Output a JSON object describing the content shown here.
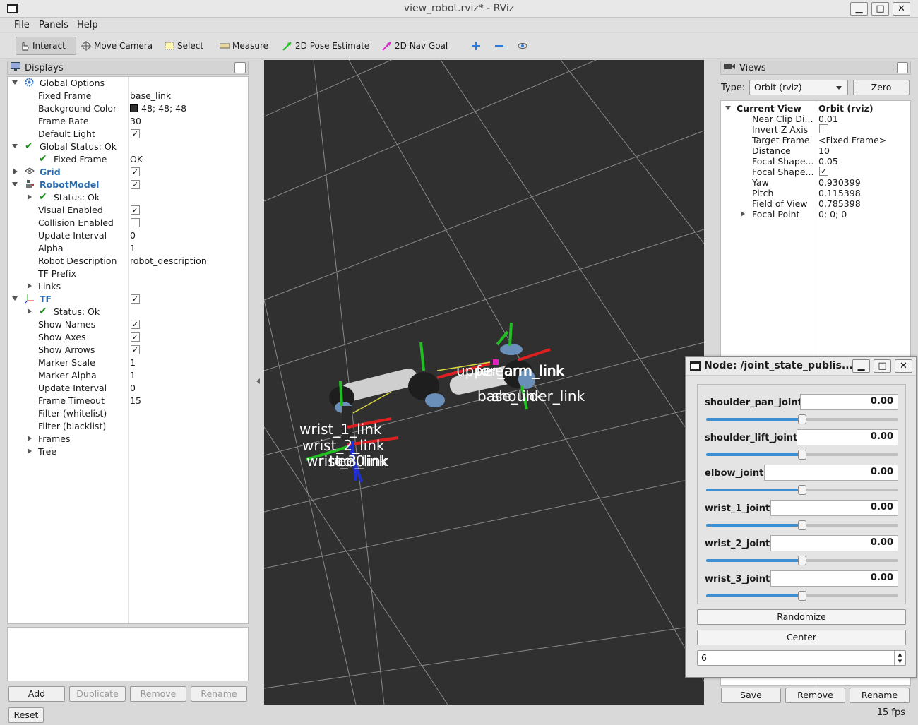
{
  "window": {
    "title": "view_robot.rviz* - RViz"
  },
  "menu": [
    "File",
    "Panels",
    "Help"
  ],
  "toolbar": {
    "interact": "Interact",
    "move_camera": "Move Camera",
    "select": "Select",
    "measure": "Measure",
    "pose_estimate": "2D Pose Estimate",
    "nav_goal": "2D Nav Goal"
  },
  "displays": {
    "title": "Displays",
    "global_options": "Global Options",
    "fixed_frame_label": "Fixed Frame",
    "fixed_frame": "base_link",
    "bg_color_label": "Background Color",
    "bg_color": "48; 48; 48",
    "frame_rate_label": "Frame Rate",
    "frame_rate": "30",
    "default_light_label": "Default Light",
    "global_status": "Global Status: Ok",
    "fixed_frame_status_label": "Fixed Frame",
    "fixed_frame_status": "OK",
    "grid": "Grid",
    "robot_model": "RobotModel",
    "status_ok": "Status: Ok",
    "visual_enabled": "Visual Enabled",
    "collision_enabled": "Collision Enabled",
    "update_interval_label": "Update Interval",
    "update_interval": "0",
    "alpha_label": "Alpha",
    "alpha": "1",
    "robot_desc_label": "Robot Description",
    "robot_desc": "robot_description",
    "tf_prefix": "TF Prefix",
    "links": "Links",
    "tf": "TF",
    "tf_status": "Status: Ok",
    "show_names": "Show Names",
    "show_axes": "Show Axes",
    "show_arrows": "Show Arrows",
    "marker_scale_label": "Marker Scale",
    "marker_scale": "1",
    "marker_alpha_label": "Marker Alpha",
    "marker_alpha": "1",
    "tf_update_interval_label": "Update Interval",
    "tf_update_interval": "0",
    "frame_timeout_label": "Frame Timeout",
    "frame_timeout": "15",
    "filter_white": "Filter (whitelist)",
    "filter_black": "Filter (blacklist)",
    "frames": "Frames",
    "tree": "Tree",
    "buttons": {
      "add": "Add",
      "duplicate": "Duplicate",
      "remove": "Remove",
      "rename": "Rename",
      "reset": "Reset"
    }
  },
  "scene": {
    "labels": [
      "wrist_1_link",
      "wrist_2_link",
      "wrist_3_link",
      "tool0",
      "ee_link",
      "upper_arm_link",
      "forearm_link",
      "base_link",
      "shoulder_link"
    ]
  },
  "views": {
    "title": "Views",
    "type_label": "Type:",
    "type_value": "Orbit (rviz)",
    "zero": "Zero",
    "current_view": "Current View",
    "current_view_val": "Orbit (rviz)",
    "rows": [
      {
        "label": "Near Clip Di...",
        "value": "0.01"
      },
      {
        "label": "Invert Z Axis",
        "value": ""
      },
      {
        "label": "Target Frame",
        "value": "<Fixed Frame>"
      },
      {
        "label": "Distance",
        "value": "10"
      },
      {
        "label": "Focal Shape...",
        "value": "0.05"
      },
      {
        "label": "Focal Shape...",
        "value": ""
      },
      {
        "label": "Yaw",
        "value": "0.930399"
      },
      {
        "label": "Pitch",
        "value": "0.115398"
      },
      {
        "label": "Field of View",
        "value": "0.785398"
      },
      {
        "label": "Focal Point",
        "value": "0; 0; 0"
      }
    ],
    "buttons": {
      "save": "Save",
      "remove": "Remove",
      "rename": "Rename"
    }
  },
  "jsp": {
    "title": "Node: /joint_state_publis...",
    "joints": [
      {
        "name": "shoulder_pan_joint",
        "value": "0.00",
        "fraction": 0.5
      },
      {
        "name": "shoulder_lift_joint",
        "value": "0.00",
        "fraction": 0.5
      },
      {
        "name": "elbow_joint",
        "value": "0.00",
        "fraction": 0.5
      },
      {
        "name": "wrist_1_joint",
        "value": "0.00",
        "fraction": 0.5
      },
      {
        "name": "wrist_2_joint",
        "value": "0.00",
        "fraction": 0.5
      },
      {
        "name": "wrist_3_joint",
        "value": "0.00",
        "fraction": 0.5
      }
    ],
    "randomize": "Randomize",
    "center": "Center",
    "spin_value": "6"
  },
  "status": {
    "fps": "15 fps"
  }
}
